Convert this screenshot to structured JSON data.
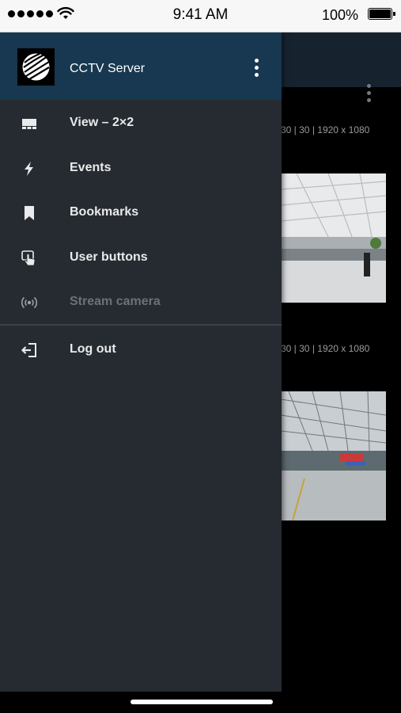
{
  "status_bar": {
    "time": "9:41 AM",
    "battery": "100%"
  },
  "drawer": {
    "server_name": "CCTV Server",
    "items": [
      {
        "label": "View – 2×2",
        "icon": "grid-view-icon",
        "enabled": true
      },
      {
        "label": "Events",
        "icon": "lightning-icon",
        "enabled": true
      },
      {
        "label": "Bookmarks",
        "icon": "bookmark-icon",
        "enabled": true
      },
      {
        "label": "User buttons",
        "icon": "touch-hand-icon",
        "enabled": true
      },
      {
        "label": "Stream camera",
        "icon": "broadcast-icon",
        "enabled": false
      },
      {
        "label": "Log out",
        "icon": "logout-icon",
        "enabled": true
      }
    ]
  },
  "background": {
    "cameras": [
      {
        "meta": "30 | 30 | 1920 x 1080",
        "scene": "airport-terminal-hall"
      },
      {
        "meta": "30 | 30 | 1920 x 1080",
        "scene": "airport-check-in-hall"
      }
    ]
  },
  "colors": {
    "drawer_bg": "#262b31",
    "drawer_header_bg": "#173850",
    "app_header_bg": "#16232f",
    "disabled_text": "#6c7177"
  }
}
